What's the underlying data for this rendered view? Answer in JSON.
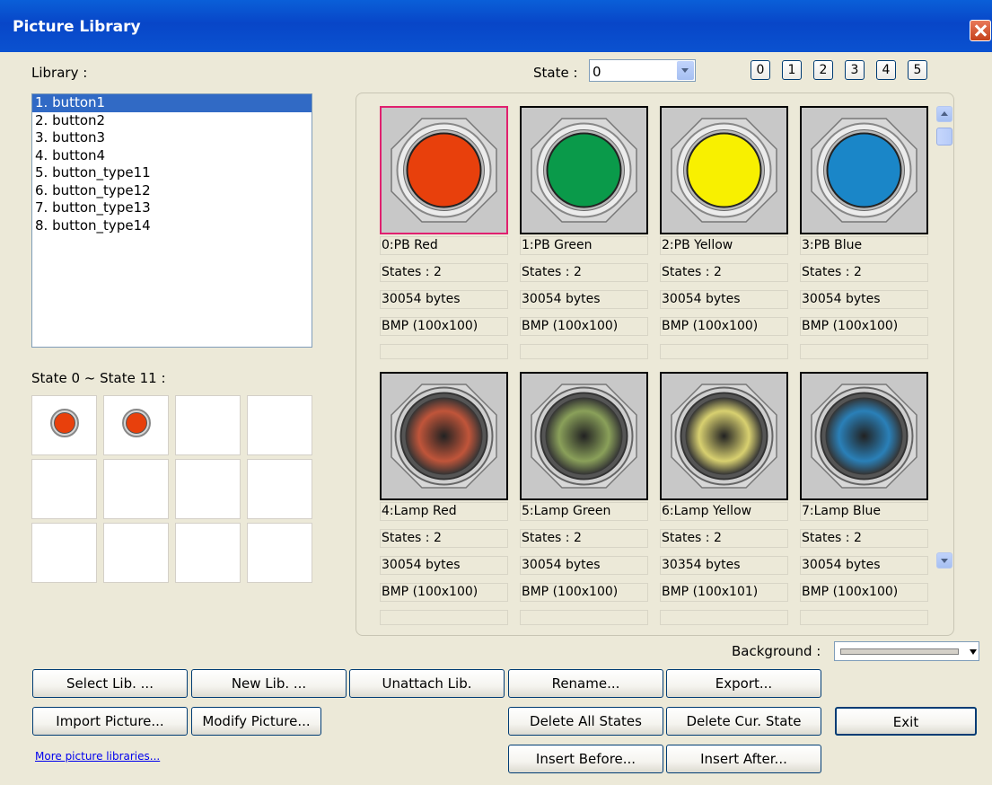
{
  "window": {
    "title": "Picture Library"
  },
  "library": {
    "label": "Library :",
    "items": [
      "1. button1",
      "2. button2",
      "3. button3",
      "4. button4",
      "5. button_type11",
      "6. button_type12",
      "7. button_type13",
      "8. button_type14"
    ],
    "selected_index": 0
  },
  "state": {
    "label": "State :",
    "value": "0",
    "quick_buttons": [
      "0",
      "1",
      "2",
      "3",
      "4",
      "5"
    ]
  },
  "state_grid": {
    "label": "State 0 ~ State 11 :",
    "cells_with_picture": [
      0,
      1
    ]
  },
  "pictures": [
    {
      "name": "0:PB Red",
      "states": "States : 2",
      "size": "30054 bytes",
      "format": "BMP (100x100)",
      "color": "#e8400c",
      "kind": "button",
      "selected": true
    },
    {
      "name": "1:PB Green",
      "states": "States : 2",
      "size": "30054 bytes",
      "format": "BMP (100x100)",
      "color": "#0a9a4a",
      "kind": "button"
    },
    {
      "name": "2:PB Yellow",
      "states": "States : 2",
      "size": "30054 bytes",
      "format": "BMP (100x100)",
      "color": "#f8f000",
      "kind": "button"
    },
    {
      "name": "3:PB Blue",
      "states": "States : 2",
      "size": "30054 bytes",
      "format": "BMP (100x100)",
      "color": "#1a86c8",
      "kind": "button"
    },
    {
      "name": "4:Lamp Red",
      "states": "States : 2",
      "size": "30054 bytes",
      "format": "BMP (100x100)",
      "color": "#c0553a",
      "kind": "lamp"
    },
    {
      "name": "5:Lamp Green",
      "states": "States : 2",
      "size": "30054 bytes",
      "format": "BMP (100x100)",
      "color": "#8aa05a",
      "kind": "lamp"
    },
    {
      "name": "6:Lamp Yellow",
      "states": "States : 2",
      "size": "30354 bytes",
      "format": "BMP (100x101)",
      "color": "#d8d070",
      "kind": "lamp"
    },
    {
      "name": "7:Lamp Blue",
      "states": "States : 2",
      "size": "30054 bytes",
      "format": "BMP (100x100)",
      "color": "#2a80b8",
      "kind": "lamp"
    }
  ],
  "background": {
    "label": "Background :"
  },
  "buttons": {
    "select_lib": "Select Lib. ...",
    "new_lib": "New Lib. ...",
    "unattach_lib": "Unattach Lib.",
    "rename": "Rename...",
    "export": "Export...",
    "import_picture": "Import Picture...",
    "modify_picture": "Modify Picture...",
    "delete_all_states": "Delete All States",
    "delete_cur_state": "Delete Cur. State",
    "exit": "Exit",
    "insert_before": "Insert Before...",
    "insert_after": "Insert After..."
  },
  "more_link": "More picture libraries..."
}
